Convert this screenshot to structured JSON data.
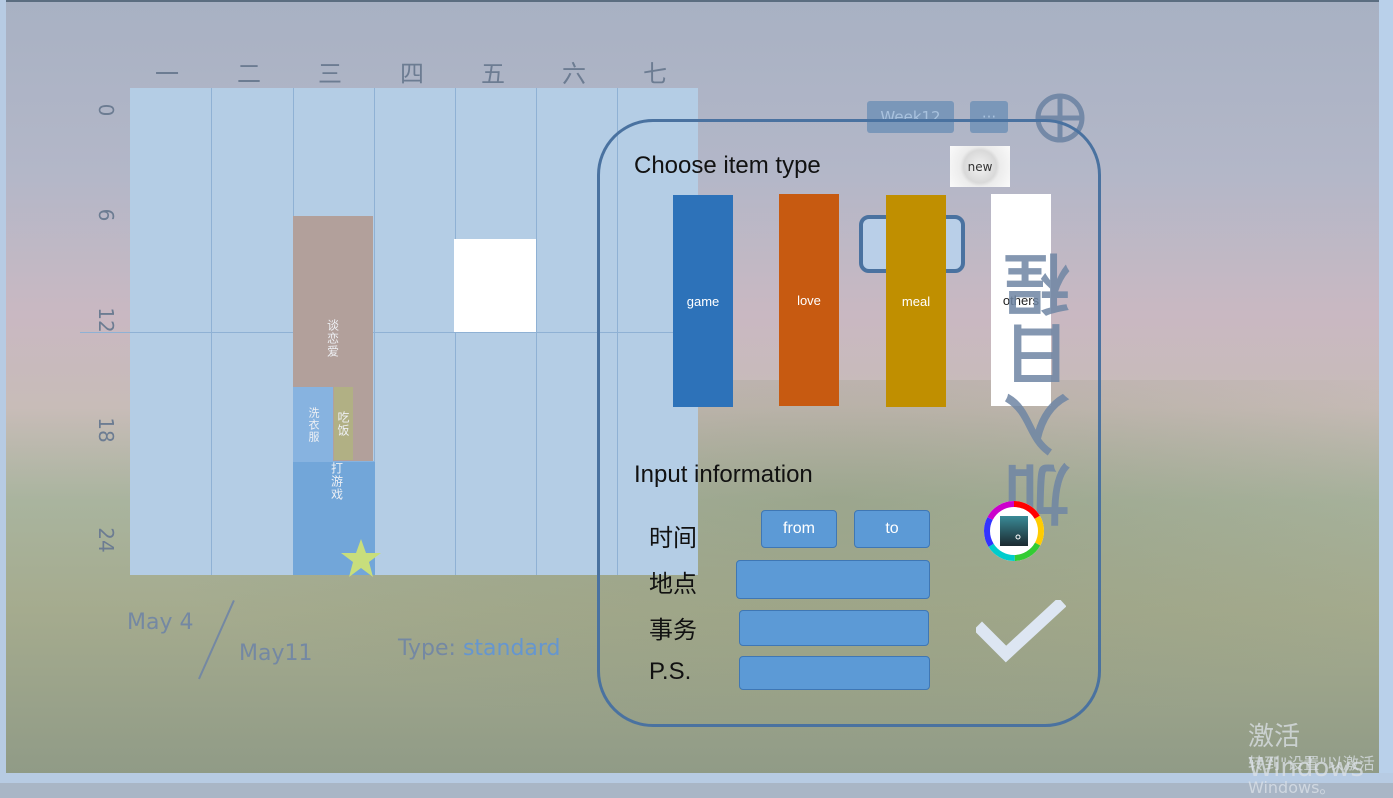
{
  "week_days": [
    "一",
    "二",
    "三",
    "四",
    "五",
    "六",
    "七"
  ],
  "hours": [
    "0",
    "6",
    "12",
    "18",
    "24"
  ],
  "events": {
    "love": "谈恋爱",
    "wash": "洗衣服",
    "meal": "吃饭",
    "game": "打游戏"
  },
  "date_range": {
    "start": "May 4",
    "end": "May11"
  },
  "type_info": {
    "label": "Type: ",
    "value": "standard"
  },
  "toolbar": {
    "week": "Week12",
    "more": "···"
  },
  "panel": {
    "choose_title": "Choose item type",
    "new_label": "new",
    "item_types": [
      "game",
      "love",
      "meal",
      "others"
    ],
    "input_title": "Input information",
    "side_caption": "加入日程",
    "fields": {
      "time_label": "时间",
      "from_label": "from",
      "to_label": "to",
      "place_label": "地点",
      "affair_label": "事务",
      "ps_label": "P.S."
    }
  },
  "watermark": {
    "line1": "激活 Windows",
    "line2": "转到\"设置\"以激活 Windows。"
  },
  "colors": {
    "game": "#2d72b9",
    "love": "#c75a11",
    "meal": "#c08f00",
    "others": "#ffffff",
    "accent": "#4a72a0"
  }
}
